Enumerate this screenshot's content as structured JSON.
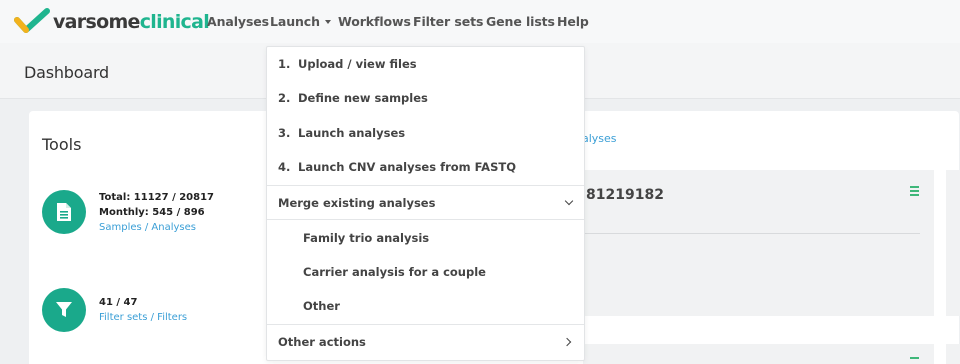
{
  "brand": {
    "name_dark": "varsome",
    "name_green": "clinical",
    "accent": "#1fb58f"
  },
  "nav": {
    "items": [
      "Analyses",
      "Launch",
      "Workflows",
      "Filter sets",
      "Gene lists",
      "Help"
    ]
  },
  "header": {
    "title": "Dashboard"
  },
  "tools": {
    "title": "Tools",
    "stats": [
      {
        "icon": "document-icon",
        "line1": "Total: 11127 / 20817",
        "line2": "Monthly: 545 / 896",
        "link": "Samples / Analyses"
      },
      {
        "icon": "filter-icon",
        "line1": "41 / 47",
        "link": "Filter sets / Filters"
      }
    ]
  },
  "panel": {
    "link_fragment": "alyses",
    "id_fragment": "81219182"
  },
  "launch_menu": {
    "steps": [
      {
        "num": "1.",
        "label": "Upload / view files"
      },
      {
        "num": "2.",
        "label": "Define new samples"
      },
      {
        "num": "3.",
        "label": "Launch analyses"
      },
      {
        "num": "4.",
        "label": "Launch CNV analyses from FASTQ"
      }
    ],
    "merge_label": "Merge existing analyses",
    "merge_items": [
      "Family trio analysis",
      "Carrier analysis for a couple",
      "Other"
    ],
    "other_actions": "Other actions"
  }
}
